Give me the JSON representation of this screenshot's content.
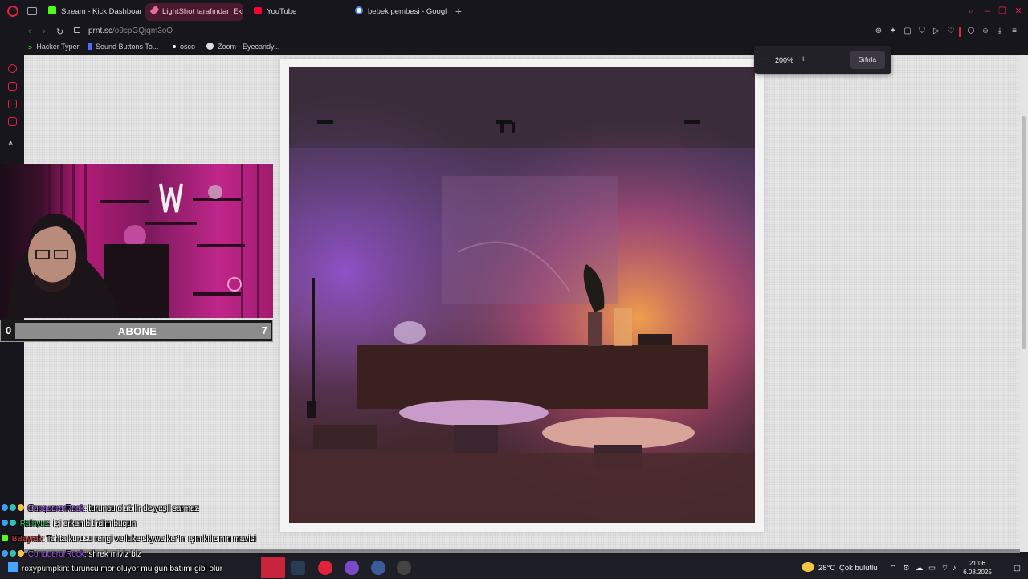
{
  "tabs": [
    {
      "label": "Stream - Kick Dashboard",
      "icon": "kick-icon",
      "color": "#53fc18",
      "active": false
    },
    {
      "label": "LightShot tarafından Ekra",
      "icon": "lightshot-icon",
      "color": "#e86aa0",
      "active": true
    },
    {
      "label": "YouTube",
      "icon": "youtube-icon",
      "color": "#ff0033",
      "active": false
    },
    {
      "label": "bebek pembesi - Google'",
      "icon": "google-icon",
      "color": "#4285f4",
      "active": false
    }
  ],
  "address": {
    "domain": "prnt.sc",
    "path": "/o9cpGQjqm3oO"
  },
  "bookmarks": [
    {
      "label": "Hacker Typer",
      "icon": "terminal-icon"
    },
    {
      "label": "Sound Buttons To...",
      "icon": "sound-icon"
    },
    {
      "label": "osco",
      "icon": "dot-icon"
    },
    {
      "label": "Zoom - Eyecandy...",
      "icon": "zoom-icon"
    }
  ],
  "zoom": {
    "minus": "−",
    "value": "200%",
    "plus": "+",
    "reset": "Sıfırla"
  },
  "overlay": {
    "left_count": "0",
    "title": "ABONE",
    "right_count": "7"
  },
  "chat": [
    {
      "user": "ConquerorRock",
      "user_color": "#a855f7",
      "message": ": turuncu olabilir de yeşil sarmaz"
    },
    {
      "user": "Ralnyus",
      "user_color": "#22c55e",
      "message": ": işi erken bitirdim bugun"
    },
    {
      "user": "BBayrak",
      "user_color": "#ef4444",
      "message": ": Tahta kurusu rengi ve luke skywalker'ın ışın kılıcının mavisi"
    },
    {
      "user": "ConquerorRock",
      "user_color": "#a855f7",
      "message": ": shrek miyiz biz"
    },
    {
      "user": "roxypumpkin",
      "user_color": "#f0f0f0",
      "message": ": turuncu mor oluyor mu gun batımı gibi olur"
    }
  ],
  "taskbar": {
    "weather_temp": "28°C",
    "weather_desc": "Çok bulutlu",
    "time": "21:06",
    "date": "6.08.2025"
  },
  "colors": {
    "accent": "#e0243c",
    "active_tab": "#4a1a2e"
  }
}
